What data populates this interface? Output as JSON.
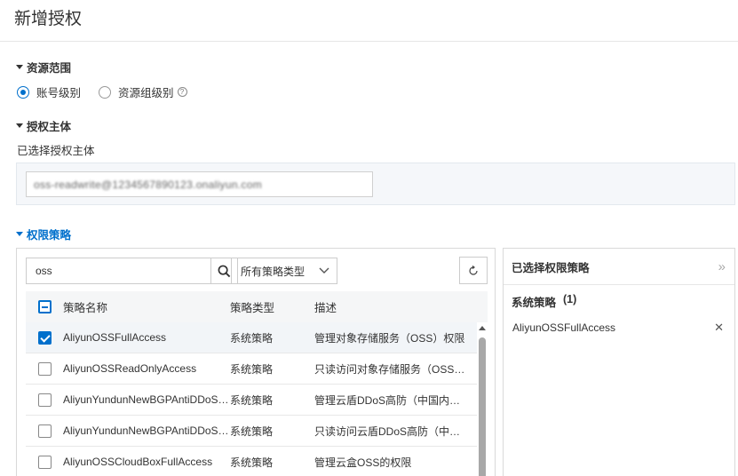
{
  "page": {
    "title": "新增授权"
  },
  "resource_scope": {
    "label": "资源范围",
    "options": [
      {
        "label": "账号级别",
        "checked": true
      },
      {
        "label": "资源组级别",
        "checked": false
      }
    ]
  },
  "principal": {
    "label": "授权主体",
    "sub_label": "已选择授权主体",
    "value": "oss-readwrite@1234567890123.onaliyun.com"
  },
  "policies": {
    "label": "权限策略",
    "search_value": "oss",
    "type_filter": "所有策略类型",
    "columns": [
      "策略名称",
      "策略类型",
      "描述"
    ],
    "rows": [
      {
        "name": "AliyunOSSFullAccess",
        "type": "系统策略",
        "desc": "管理对象存储服务（OSS）权限",
        "checked": true
      },
      {
        "name": "AliyunOSSReadOnlyAccess",
        "type": "系统策略",
        "desc": "只读访问对象存储服务（OSS）权限",
        "checked": false
      },
      {
        "name": "AliyunYundunNewBGPAntiDDoSServerFullAccess",
        "type": "系统策略",
        "desc": "管理云盾DDoS高防（中国内地）的权限",
        "checked": false
      },
      {
        "name": "AliyunYundunNewBGPAntiDDoSServerReadOnlyAccess",
        "type": "系统策略",
        "desc": "只读访问云盾DDoS高防（中国内地）的权限",
        "checked": false
      },
      {
        "name": "AliyunOSSCloudBoxFullAccess",
        "type": "系统策略",
        "desc": "管理云盒OSS的权限",
        "checked": false
      }
    ]
  },
  "selected_panel": {
    "title": "已选择权限策略",
    "group_label": "系统策略",
    "group_count": "(1)",
    "items": [
      "AliyunOSSFullAccess"
    ]
  },
  "colors": {
    "accent": "#0070cc",
    "border": "#d9d9d9"
  }
}
